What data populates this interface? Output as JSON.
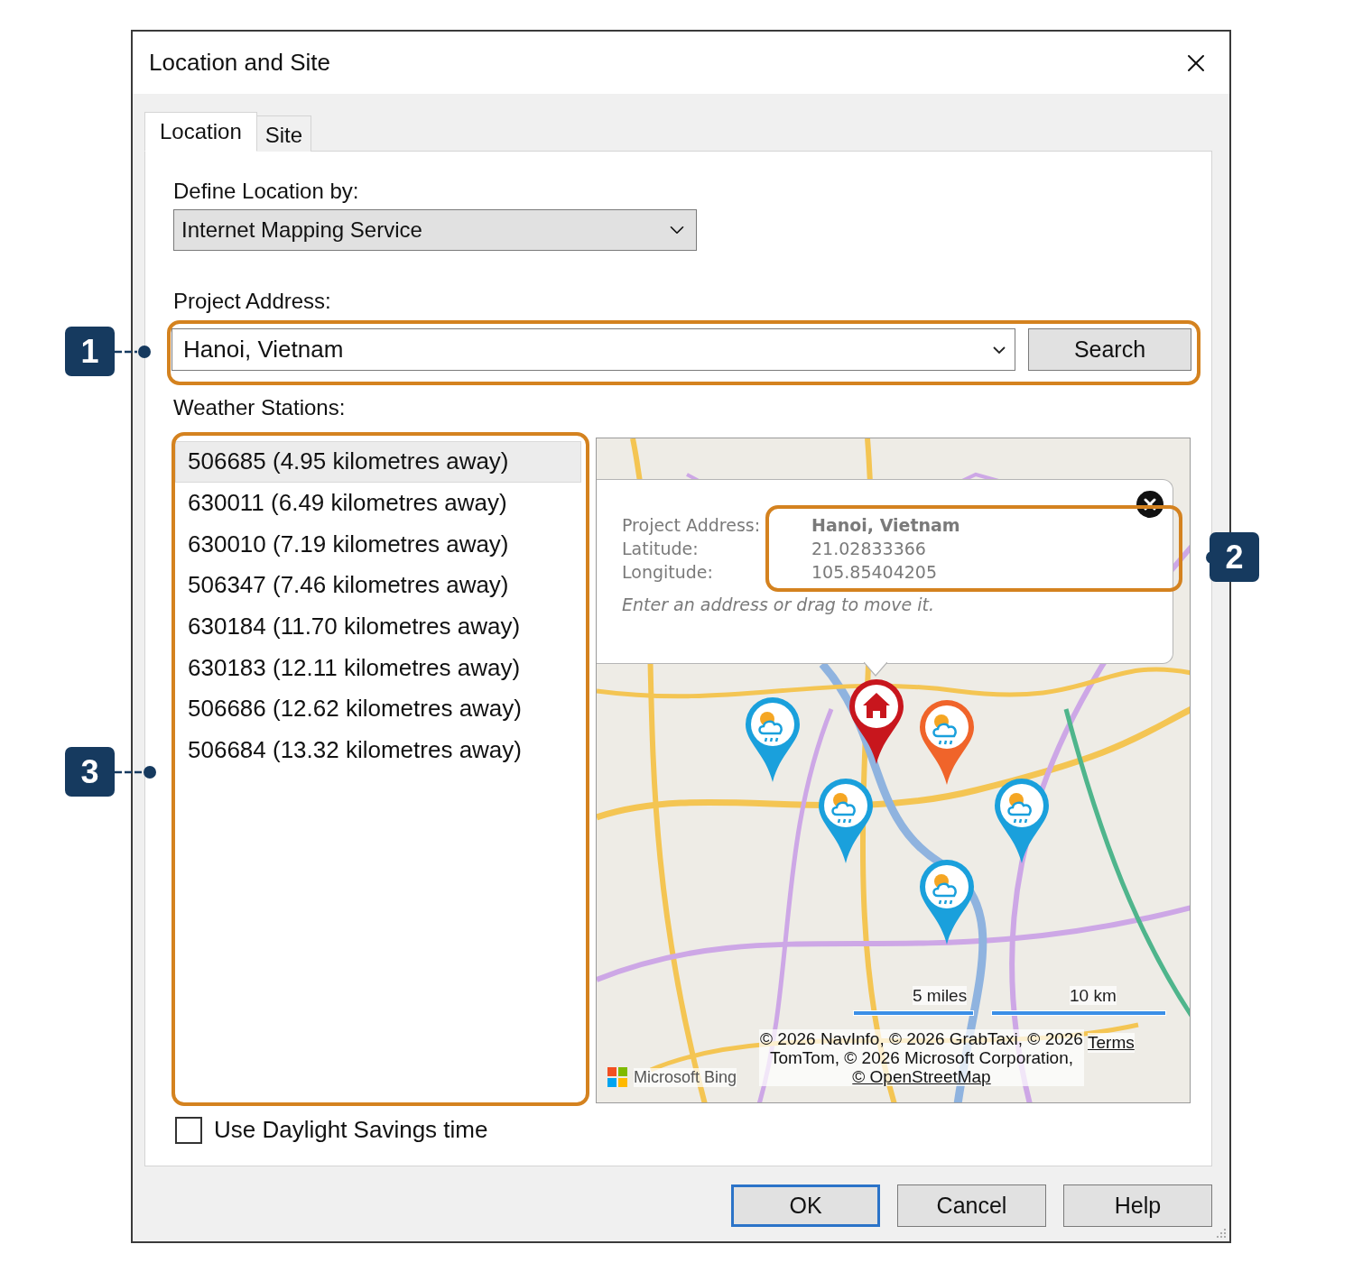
{
  "window": {
    "title": "Location and Site"
  },
  "tabs": [
    {
      "label": "Location",
      "selected": true
    },
    {
      "label": "Site",
      "selected": false
    }
  ],
  "define_location": {
    "label": "Define Location by:",
    "value": "Internet Mapping Service"
  },
  "project_address": {
    "label": "Project Address:",
    "value": "Hanoi, Vietnam",
    "button": "Search"
  },
  "weather_stations": {
    "label": "Weather Stations:",
    "items": [
      {
        "text": "506685 (4.95 kilometres away)",
        "selected": true
      },
      {
        "text": "630011 (6.49 kilometres away)",
        "selected": false
      },
      {
        "text": "630010 (7.19 kilometres away)",
        "selected": false
      },
      {
        "text": "506347 (7.46 kilometres away)",
        "selected": false
      },
      {
        "text": "630184 (11.70 kilometres away)",
        "selected": false
      },
      {
        "text": "630183 (12.11 kilometres away)",
        "selected": false
      },
      {
        "text": "506686 (12.62 kilometres away)",
        "selected": false
      },
      {
        "text": "506684 (13.32 kilometres away)",
        "selected": false
      }
    ]
  },
  "map": {
    "popup": {
      "rows": [
        {
          "label": "Project Address:",
          "value": "Hanoi, Vietnam"
        },
        {
          "label": "Latitude:",
          "value": "21.02833366"
        },
        {
          "label": "Longitude:",
          "value": "105.85404205"
        }
      ],
      "hint": "Enter an address or drag to move it."
    },
    "markers": [
      {
        "kind": "project",
        "color": "#c8161d"
      },
      {
        "kind": "station",
        "color": "#1aa0dc"
      },
      {
        "kind": "station",
        "color": "#f0642a"
      },
      {
        "kind": "station",
        "color": "#1aa0dc"
      },
      {
        "kind": "station",
        "color": "#1aa0dc"
      },
      {
        "kind": "station",
        "color": "#1aa0dc"
      }
    ],
    "scale": [
      "5 miles",
      "10 km"
    ],
    "attribution": "© 2026 NavInfo, © 2026 GrabTaxi, © 2026 TomTom, © 2026 Microsoft Corporation,",
    "attribution_link": "© OpenStreetMap",
    "terms": "Terms",
    "provider": "Microsoft Bing"
  },
  "daylight_savings": {
    "label": "Use Daylight Savings time",
    "checked": false
  },
  "buttons": [
    {
      "label": "OK",
      "default": true
    },
    {
      "label": "Cancel",
      "default": false
    },
    {
      "label": "Help",
      "default": false
    }
  ],
  "callouts": [
    {
      "label": "1"
    },
    {
      "label": "2"
    },
    {
      "label": "3"
    }
  ]
}
